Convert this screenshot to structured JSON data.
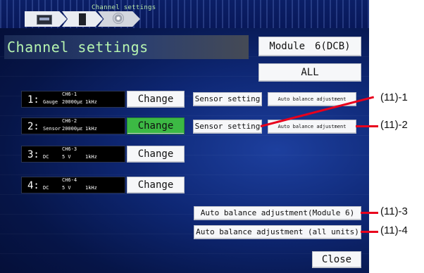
{
  "breadcrumb": {
    "current_tab_label": "Channel settings"
  },
  "page": {
    "title": "Channel settings"
  },
  "module_button": "Module　6(DCB)",
  "all_button": "ALL",
  "channels": [
    {
      "num": "1:",
      "id": "CH6-1",
      "type": "Gauge",
      "range": "20000με",
      "freq": "1kHz",
      "change_label": "Change",
      "change_active": false,
      "sensor_label": "Sensor setting",
      "autobal_label": "Auto balance adjustment"
    },
    {
      "num": "2:",
      "id": "CH6-2",
      "type": "Sensor",
      "range": "20000με",
      "freq": "1kHz",
      "change_label": "Change",
      "change_active": true,
      "sensor_label": "Sensor setting",
      "autobal_label": "Auto balance adjustment"
    },
    {
      "num": "3:",
      "id": "CH6-3",
      "type": "DC",
      "range": "5 V",
      "freq": "1kHz",
      "change_label": "Change",
      "change_active": false
    },
    {
      "num": "4:",
      "id": "CH6-4",
      "type": "DC",
      "range": "5 V",
      "freq": "1kHz",
      "change_label": "Change",
      "change_active": false
    }
  ],
  "module_balance_button": "Auto balance adjustment(Module 6)",
  "all_units_balance_button": "Auto balance adjustment (all units)",
  "close_button": "Close",
  "callouts": [
    "(11)-1",
    "(11)-2",
    "(11)-3",
    "(11)-4"
  ],
  "colors": {
    "active_change": "#3cb944",
    "callout_red": "#e8001c",
    "title_green": "#b7f5b0"
  }
}
